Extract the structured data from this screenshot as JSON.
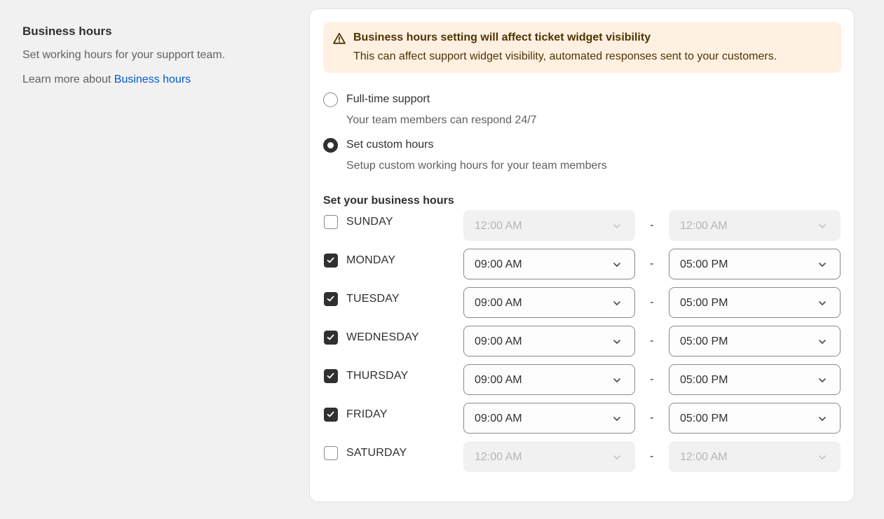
{
  "section": {
    "title": "Business hours",
    "description": "Set working hours for your support team.",
    "learn_more_prefix": "Learn more about",
    "learn_more_link": "Business hours"
  },
  "banner": {
    "title": "Business hours setting will affect ticket widget visibility",
    "text": "This can affect support widget visibility, automated responses sent to your customers.",
    "icon": "warning-triangle-icon"
  },
  "support_mode": {
    "options": [
      {
        "label": "Full-time support",
        "help": "Your team members can respond 24/7",
        "selected": false
      },
      {
        "label": "Set custom hours",
        "help": "Setup custom working hours for your team members",
        "selected": true
      }
    ]
  },
  "hours": {
    "title": "Set your business hours",
    "separator": "-",
    "days": [
      {
        "label": "SUNDAY",
        "checked": false,
        "from": "12:00 AM",
        "to": "12:00 AM"
      },
      {
        "label": "MONDAY",
        "checked": true,
        "from": "09:00 AM",
        "to": "05:00 PM"
      },
      {
        "label": "TUESDAY",
        "checked": true,
        "from": "09:00 AM",
        "to": "05:00 PM"
      },
      {
        "label": "WEDNESDAY",
        "checked": true,
        "from": "09:00 AM",
        "to": "05:00 PM"
      },
      {
        "label": "THURSDAY",
        "checked": true,
        "from": "09:00 AM",
        "to": "05:00 PM"
      },
      {
        "label": "FRIDAY",
        "checked": true,
        "from": "09:00 AM",
        "to": "05:00 PM"
      },
      {
        "label": "SATURDAY",
        "checked": false,
        "from": "12:00 AM",
        "to": "12:00 AM"
      }
    ]
  },
  "colors": {
    "link": "#005bd3",
    "banner_bg": "#fff0e2",
    "banner_text": "#4f3300",
    "checked": "#303030"
  }
}
